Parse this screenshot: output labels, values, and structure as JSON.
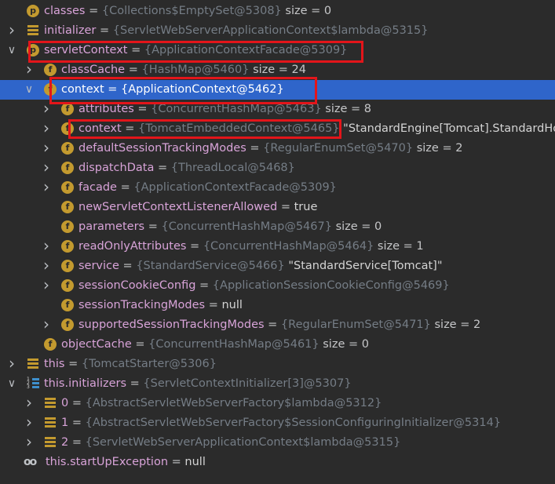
{
  "colors": {
    "background": "#2b2b2b",
    "selection": "#2f65ca",
    "field_name": "#d8a3d8",
    "value_ref": "#757d86",
    "field_icon": "#c39a2f",
    "highlight": "#e3151a"
  },
  "rows": [
    {
      "indent": 0,
      "arrow": "none",
      "icon": "p",
      "icon_name": "property-icon",
      "name": "classes",
      "ref": "{Collections$EmptySet@5308}",
      "suffix": "size = 0"
    },
    {
      "indent": 0,
      "arrow": "collapsed",
      "icon": "lines",
      "icon_name": "object-icon",
      "name": "initializer",
      "ref": "{ServletWebServerApplicationContext$lambda@5315}",
      "suffix": ""
    },
    {
      "indent": 0,
      "arrow": "expanded",
      "icon": "p",
      "icon_name": "property-icon",
      "name": "servletContext",
      "ref": "{ApplicationContextFacade@5309}",
      "suffix": ""
    },
    {
      "indent": 1,
      "arrow": "collapsed",
      "icon": "f",
      "icon_name": "field-icon",
      "name": "classCache",
      "ref": "{HashMap@5460}",
      "suffix": "size = 24"
    },
    {
      "indent": 1,
      "arrow": "expanded",
      "icon": "f",
      "icon_name": "field-icon",
      "name": "context",
      "ref": "{ApplicationContext@5462}",
      "suffix": "",
      "selected": true
    },
    {
      "indent": 2,
      "arrow": "collapsed",
      "icon": "f",
      "icon_name": "field-icon",
      "name": "attributes",
      "ref": "{ConcurrentHashMap@5463}",
      "suffix": "size = 8"
    },
    {
      "indent": 2,
      "arrow": "collapsed",
      "icon": "f",
      "icon_name": "field-icon",
      "name": "context",
      "ref": "{TomcatEmbeddedContext@5465}",
      "suffix": "\"StandardEngine[Tomcat].StandardHo"
    },
    {
      "indent": 2,
      "arrow": "collapsed",
      "icon": "f",
      "icon_name": "field-icon",
      "name": "defaultSessionTrackingModes",
      "ref": "{RegularEnumSet@5470}",
      "suffix": "size = 2"
    },
    {
      "indent": 2,
      "arrow": "collapsed",
      "icon": "f",
      "icon_name": "field-icon",
      "name": "dispatchData",
      "ref": "{ThreadLocal@5468}",
      "suffix": ""
    },
    {
      "indent": 2,
      "arrow": "collapsed",
      "icon": "f",
      "icon_name": "field-icon",
      "name": "facade",
      "ref": "{ApplicationContextFacade@5309}",
      "suffix": ""
    },
    {
      "indent": 2,
      "arrow": "none",
      "icon": "f",
      "icon_name": "field-icon",
      "name": "newServletContextListenerAllowed",
      "ref": "",
      "suffix": "true"
    },
    {
      "indent": 2,
      "arrow": "none",
      "icon": "f",
      "icon_name": "field-icon",
      "name": "parameters",
      "ref": "{ConcurrentHashMap@5467}",
      "suffix": "size = 0"
    },
    {
      "indent": 2,
      "arrow": "collapsed",
      "icon": "f",
      "icon_name": "field-icon",
      "name": "readOnlyAttributes",
      "ref": "{ConcurrentHashMap@5464}",
      "suffix": "size = 1"
    },
    {
      "indent": 2,
      "arrow": "collapsed",
      "icon": "f",
      "icon_name": "field-icon",
      "name": "service",
      "ref": "{StandardService@5466}",
      "suffix": "\"StandardService[Tomcat]\""
    },
    {
      "indent": 2,
      "arrow": "collapsed",
      "icon": "f",
      "icon_name": "field-icon",
      "name": "sessionCookieConfig",
      "ref": "{ApplicationSessionCookieConfig@5469}",
      "suffix": ""
    },
    {
      "indent": 2,
      "arrow": "none",
      "icon": "f",
      "icon_name": "field-icon",
      "name": "sessionTrackingModes",
      "ref": "",
      "suffix": "null"
    },
    {
      "indent": 2,
      "arrow": "collapsed",
      "icon": "f",
      "icon_name": "field-icon",
      "name": "supportedSessionTrackingModes",
      "ref": "{RegularEnumSet@5471}",
      "suffix": "size = 2"
    },
    {
      "indent": 1,
      "arrow": "none",
      "icon": "f",
      "icon_name": "field-icon",
      "name": "objectCache",
      "ref": "{ConcurrentHashMap@5461}",
      "suffix": "size = 0"
    },
    {
      "indent": 0,
      "arrow": "collapsed",
      "icon": "lines",
      "icon_name": "object-icon",
      "name": "this",
      "ref": "{TomcatStarter@5306}",
      "suffix": ""
    },
    {
      "indent": 0,
      "arrow": "expanded",
      "icon": "list",
      "icon_name": "array-icon",
      "name": "this.initializers",
      "ref": "{ServletContextInitializer[3]@5307}",
      "suffix": ""
    },
    {
      "indent": 1,
      "arrow": "collapsed",
      "icon": "lines",
      "icon_name": "object-icon",
      "name": "0",
      "ref": "{AbstractServletWebServerFactory$lambda@5312}",
      "suffix": ""
    },
    {
      "indent": 1,
      "arrow": "collapsed",
      "icon": "lines",
      "icon_name": "object-icon",
      "name": "1",
      "ref": "{AbstractServletWebServerFactory$SessionConfiguringInitializer@5314}",
      "suffix": ""
    },
    {
      "indent": 1,
      "arrow": "collapsed",
      "icon": "lines",
      "icon_name": "object-icon",
      "name": "2",
      "ref": "{ServletWebServerApplicationContext$lambda@5315}",
      "suffix": ""
    },
    {
      "indent": 0,
      "arrow": "none",
      "icon": "glasses",
      "icon_name": "watch-icon",
      "name": "this.startUpException",
      "ref": "",
      "suffix": "null"
    }
  ]
}
